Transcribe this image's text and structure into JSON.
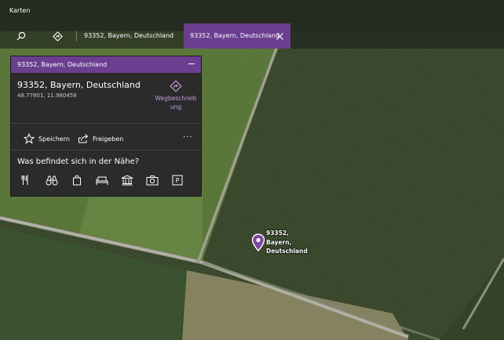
{
  "app": {
    "title": "Karten"
  },
  "toolbar": {
    "search_icon": "search-icon",
    "directions_icon": "directions-icon",
    "location_text": "93352, Bayern, Deutschland",
    "active_tab_label": "93352, Bayern, Deutschland",
    "close_icon": "close-icon"
  },
  "panel": {
    "header_title": "93352, Bayern, Deutschland",
    "minimize_icon": "minimize-icon",
    "place_name": "93352, Bayern, Deutschland",
    "coordinates": "48.77801, 11.980458",
    "route_label": "Wegbeschreibung",
    "actions": {
      "save_label": "Speichern",
      "share_label": "Freigeben",
      "more_label": "···"
    },
    "nearby": {
      "title": "Was befindet sich in der Nähe?",
      "icons": [
        "restaurant-icon",
        "binoculars-icon",
        "shopping-bag-icon",
        "hotel-bed-icon",
        "museum-icon",
        "camera-icon",
        "parking-icon"
      ],
      "parking_text": "P"
    }
  },
  "map": {
    "pin_label_lines": [
      "93352,",
      "Bayern,",
      "Deutschland"
    ]
  },
  "colors": {
    "accent": "#6b3e90",
    "panel_bg": "#2b2b2b",
    "link": "#c59be0",
    "field_dark": "#3a4a2c",
    "field_light": "#5f7a3e"
  }
}
